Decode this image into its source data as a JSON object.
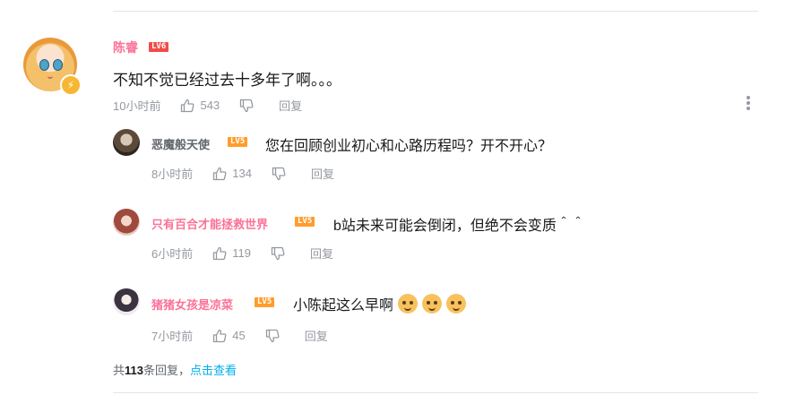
{
  "main_comment": {
    "username": "陈睿",
    "level": "LV6",
    "text": "不知不觉已经过去十多年了啊。。。",
    "time": "10小时前",
    "likes": "543",
    "reply_label": "回复"
  },
  "replies": [
    {
      "username": "恶魔般天使",
      "level": "LV5",
      "text": "您在回顾创业初心和心路历程吗？开不开心？",
      "time": "8小时前",
      "likes": "134",
      "reply_label": "回复"
    },
    {
      "username": "只有百合才能拯救世界",
      "level": "LV5",
      "text": "b站未来可能会倒闭，但绝不会变质＾＾",
      "time": "6小时前",
      "likes": "119",
      "reply_label": "回复"
    },
    {
      "username": "猪猪女孩是凉菜",
      "level": "LV5",
      "text": "小陈起这么早啊",
      "time": "7小时前",
      "likes": "45",
      "reply_label": "回复"
    }
  ],
  "summary": {
    "prefix": "共",
    "count": "113",
    "suffix": "条回复，",
    "link": "点击查看"
  },
  "colors": {
    "vip_name": "#fb7299",
    "normal_name": "#61666d",
    "link": "#00aeec",
    "lv6": "#f04c49",
    "lv5": "#ff9c2c"
  }
}
